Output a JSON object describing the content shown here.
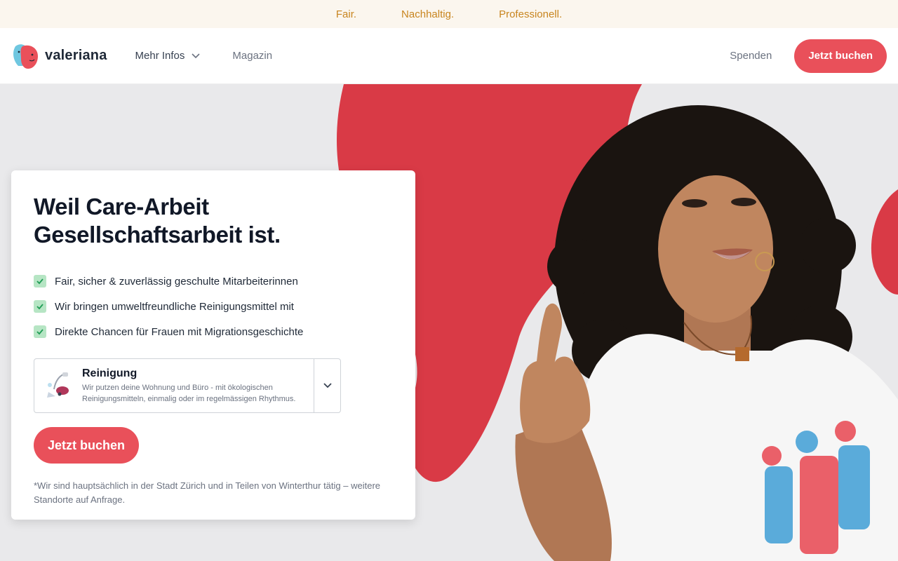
{
  "topbar": {
    "items": [
      "Fair.",
      "Nachhaltig.",
      "Professionell."
    ]
  },
  "header": {
    "logo_text": "valeriana",
    "nav": {
      "more_info": "Mehr Infos",
      "magazine": "Magazin"
    },
    "donate": "Spenden",
    "book": "Jetzt buchen"
  },
  "hero": {
    "title_line1": "Weil Care-Arbeit",
    "title_line2": "Gesellschaftsarbeit ist.",
    "features": [
      "Fair, sicher & zuverlässig geschulte Mitarbeiterinnen",
      "Wir bringen umweltfreundliche Reinigungsmittel mit",
      "Direkte Chancen für Frauen mit Migrationsgeschichte"
    ],
    "service": {
      "title": "Reinigung",
      "desc_line1": "Wir putzen deine Wohnung und Büro - mit ökologischen",
      "desc_line2": "Reinigungsmitteln, einmalig oder im regelmässigen Rhythmus."
    },
    "book": "Jetzt buchen",
    "note": "*Wir sind hauptsächlich in der Stadt Zürich und in Teilen von Winterthur tätig – weitere Standorte auf Anfrage."
  },
  "colors": {
    "accent": "#e9505a",
    "tagline": "#c8851f",
    "check": "#b6e5c4"
  }
}
